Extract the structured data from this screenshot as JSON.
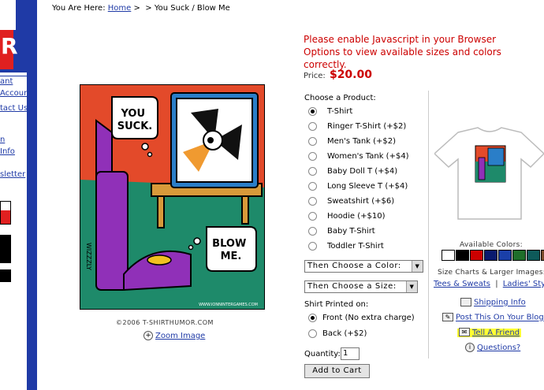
{
  "breadcrumb": {
    "prefix": "You Are Here:",
    "home": "Home",
    "sep1": ">",
    "sep2": ">",
    "current": "You Suck / Blow Me"
  },
  "sidebar": {
    "logo_letter": "R",
    "links": [
      "ant",
      "Account",
      "tact Us",
      "n",
      "Info",
      "sletter"
    ]
  },
  "comic": {
    "bubble1": "YOU SUCK.",
    "bubble2": "BLOW ME.",
    "signature": "WIZZZLY",
    "site_small": "WWW.IONNINTERGAMES.COM",
    "copyright": "©2006 T-SHIRTHUMOR.COM",
    "zoom_label": "Zoom Image"
  },
  "js_warning": "Please enable Javascript in your Browser Options to view available sizes and colors correctly.",
  "price": {
    "label": "Price:",
    "value": "$20.00"
  },
  "product": {
    "label": "Choose a Product:",
    "options": [
      {
        "label": "T-Shirt",
        "selected": true
      },
      {
        "label": "Ringer T-Shirt (+$2)",
        "selected": false
      },
      {
        "label": "Men's Tank (+$2)",
        "selected": false
      },
      {
        "label": "Women's Tank (+$4)",
        "selected": false
      },
      {
        "label": "Baby Doll T (+$4)",
        "selected": false
      },
      {
        "label": "Long Sleeve T (+$4)",
        "selected": false
      },
      {
        "label": "Sweatshirt (+$6)",
        "selected": false
      },
      {
        "label": "Hoodie (+$10)",
        "selected": false
      },
      {
        "label": "Baby T-Shirt",
        "selected": false
      },
      {
        "label": "Toddler T-Shirt",
        "selected": false
      }
    ]
  },
  "color_select": "Then Choose a Color:",
  "size_select": "Then Choose a Size:",
  "printed": {
    "label": "Shirt Printed on:",
    "options": [
      {
        "label": "Front (No extra charge)",
        "selected": true
      },
      {
        "label": "Back (+$2)",
        "selected": false
      }
    ]
  },
  "quantity": {
    "label": "Quantity:",
    "value": "1"
  },
  "add_to_cart": "Add to Cart",
  "right": {
    "available_colors": "Available Colors:",
    "swatches": [
      "#ffffff",
      "#000000",
      "#cc0000",
      "#0a1a6e",
      "#1a3fa8",
      "#1f6e2a",
      "#0e5a5a",
      "#7a4a2a"
    ],
    "size_charts": "Size Charts & Larger Images:",
    "tees_link": "Tees & Sweats",
    "link_sep": "|",
    "ladies_link": "Ladies' Style",
    "shipping": "Shipping Info",
    "blog": "Post This On Your Blog",
    "tell_friend": "Tell A Friend",
    "questions": "Questions?"
  },
  "colors": {
    "brand_blue": "#1f3aa6",
    "price_red": "#cc0000",
    "highlight": "#ffff33"
  }
}
